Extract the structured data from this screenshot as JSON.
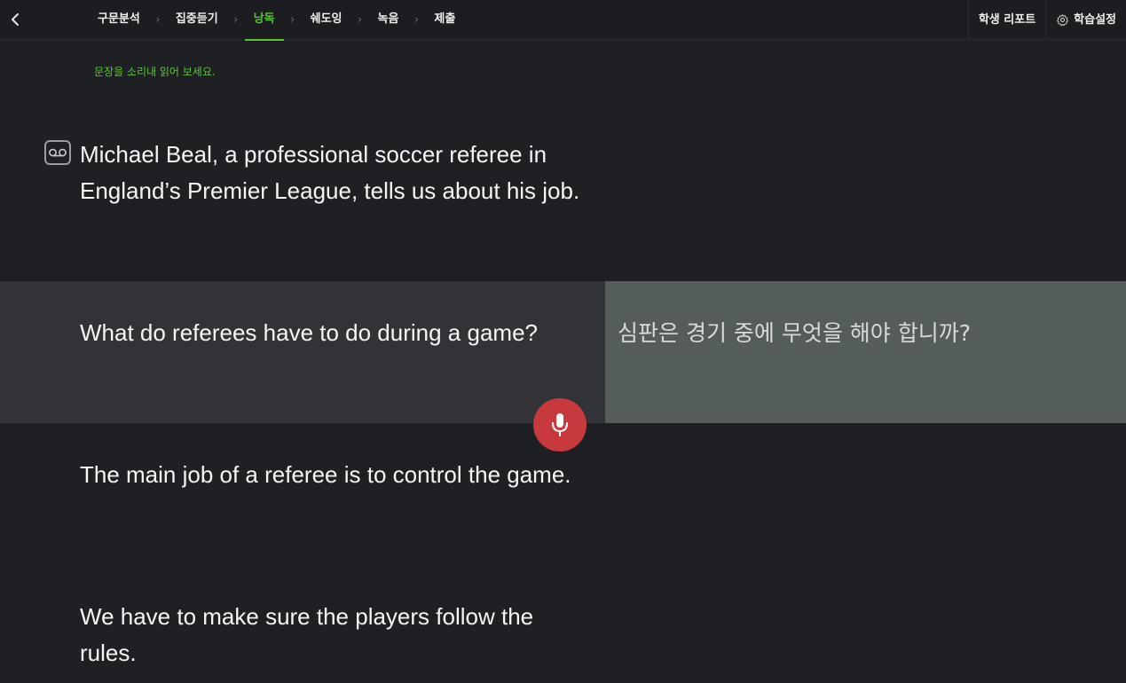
{
  "header": {
    "steps": [
      {
        "label": "구문분석",
        "active": false
      },
      {
        "label": "집중듣기",
        "active": false
      },
      {
        "label": "낭독",
        "active": true
      },
      {
        "label": "쉐도잉",
        "active": false
      },
      {
        "label": "녹음",
        "active": false
      },
      {
        "label": "제출",
        "active": false
      }
    ],
    "report_label": "학생 리포트",
    "settings_label": "학습설정"
  },
  "instruction": "문장을 소리내 읽어 보세요.",
  "sentences": [
    {
      "en": "Michael Beal, a professional soccer referee in England’s Premier League, tells us about his job."
    },
    {
      "en": "What do referees have to do during a game?",
      "ko": "심판은 경기 중에 무엇을 해야 합니까?"
    },
    {
      "en": "The main job of a referee is to control the game."
    },
    {
      "en": "We have to make sure the players follow the rules."
    }
  ],
  "icons": {
    "back": "chevron-left-icon",
    "separator": "chevron-right-icon",
    "settings": "gear-icon",
    "voicemail": "voicemail-icon",
    "mic": "microphone-icon"
  },
  "colors": {
    "accent": "#5ec136",
    "background": "#1f2023",
    "highlight_row": "#323337",
    "translation_panel": "#555d5a",
    "record_button": "#c8393d"
  }
}
